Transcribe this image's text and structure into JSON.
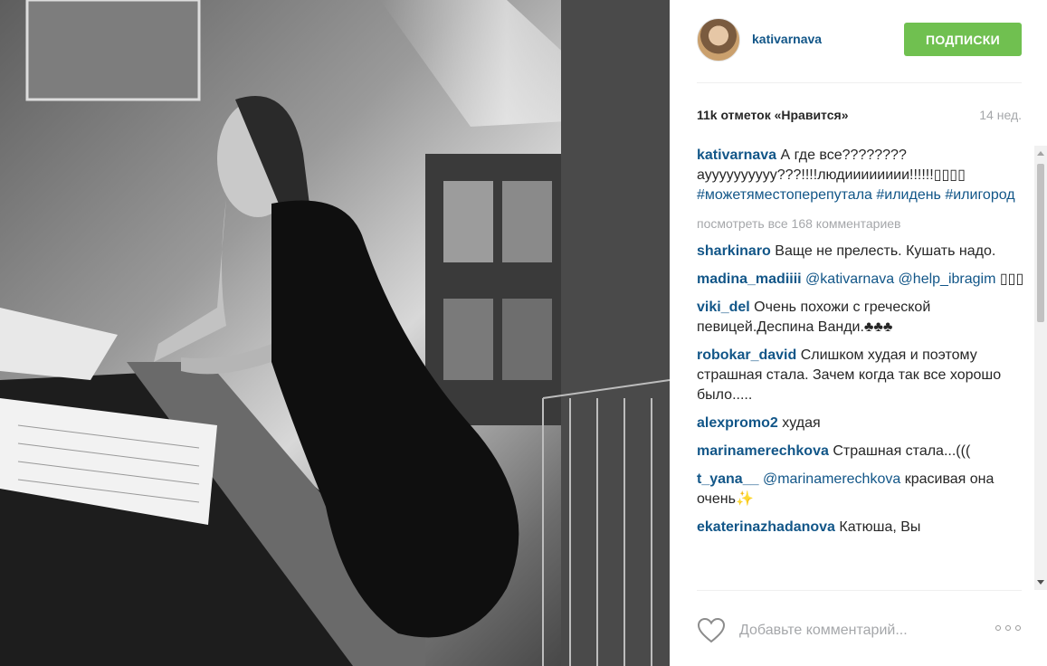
{
  "post": {
    "author": "kativarnava",
    "follow_button": "ПОДПИСКИ",
    "likes": "11k отметок «Нравится»",
    "age": "14 нед.",
    "caption": {
      "user": "kativarnava",
      "text": "А где все???????? ауууууууууу???!!!!людииииииии!!!!!!",
      "emoji": "▯▯▯▯",
      "hashtags": "#можетяместоперепутала #илидень #илигород"
    },
    "view_all": "посмотреть все 168 комментариев",
    "comments": [
      {
        "user": "sharkinaro",
        "text": "Ваще не прелесть. Кушать надо."
      },
      {
        "user": "madina_madiiii",
        "mention": "@kativarnava @help_ibragim",
        "text": "▯▯▯"
      },
      {
        "user": "viki_del",
        "text": "Очень похожи с греческой певицей.Деспина Ванди.♣♣♣"
      },
      {
        "user": "robokar_david",
        "text": "Слишком худая и поэтому страшная стала. Зачем когда так все хорошо было....."
      },
      {
        "user": "alexpromo2",
        "text": "худая"
      },
      {
        "user": "marinamerechkova",
        "text": "Страшная стала...((("
      },
      {
        "user": "t_yana__",
        "mention": "@marinamerechkova",
        "text": "красивая она очень✨"
      },
      {
        "user": "ekaterinazhadanova",
        "text": "Катюша, Вы"
      }
    ],
    "comment_placeholder": "Добавьте комментарий...",
    "icons": {
      "like": "heart-icon",
      "more": "more-options-icon",
      "avatar": "avatar"
    },
    "colors": {
      "accent_link": "#125688",
      "follow_green": "#70c050",
      "muted": "#a5a7aa"
    }
  }
}
